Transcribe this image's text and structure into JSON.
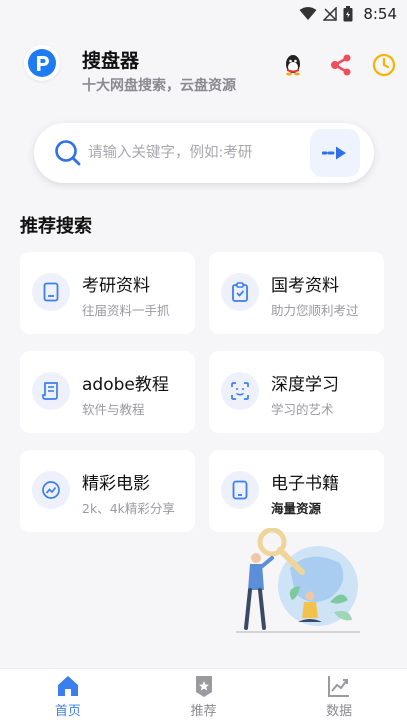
{
  "status": {
    "time": "8:54"
  },
  "header": {
    "title": "搜盘器",
    "subtitle": "十大网盘搜索，云盘资源"
  },
  "search": {
    "placeholder": "请输入关键字，例如:考研",
    "value": ""
  },
  "section_title": "推荐搜索",
  "cards": [
    {
      "title": "考研资料",
      "sub": "往届资料一手抓",
      "icon": "document-icon"
    },
    {
      "title": "国考资料",
      "sub": "助力您顺利考过",
      "icon": "clipboard-check-icon"
    },
    {
      "title": "adobe教程",
      "sub": "软件与教程",
      "icon": "scroll-icon"
    },
    {
      "title": "深度学习",
      "sub": "学习的艺术",
      "icon": "face-scan-icon"
    },
    {
      "title": "精彩电影",
      "sub": "2k、4k精彩分享",
      "icon": "trend-chart-icon"
    },
    {
      "title": "电子书籍",
      "sub": "海量资源",
      "icon": "tablet-icon"
    }
  ],
  "nav": [
    {
      "label": "首页",
      "icon": "home-icon",
      "active": true
    },
    {
      "label": "推荐",
      "icon": "star-badge-icon",
      "active": false
    },
    {
      "label": "数据",
      "icon": "chart-icon",
      "active": false
    }
  ],
  "colors": {
    "accent": "#3a7ff0",
    "background": "#f6f6f8"
  }
}
